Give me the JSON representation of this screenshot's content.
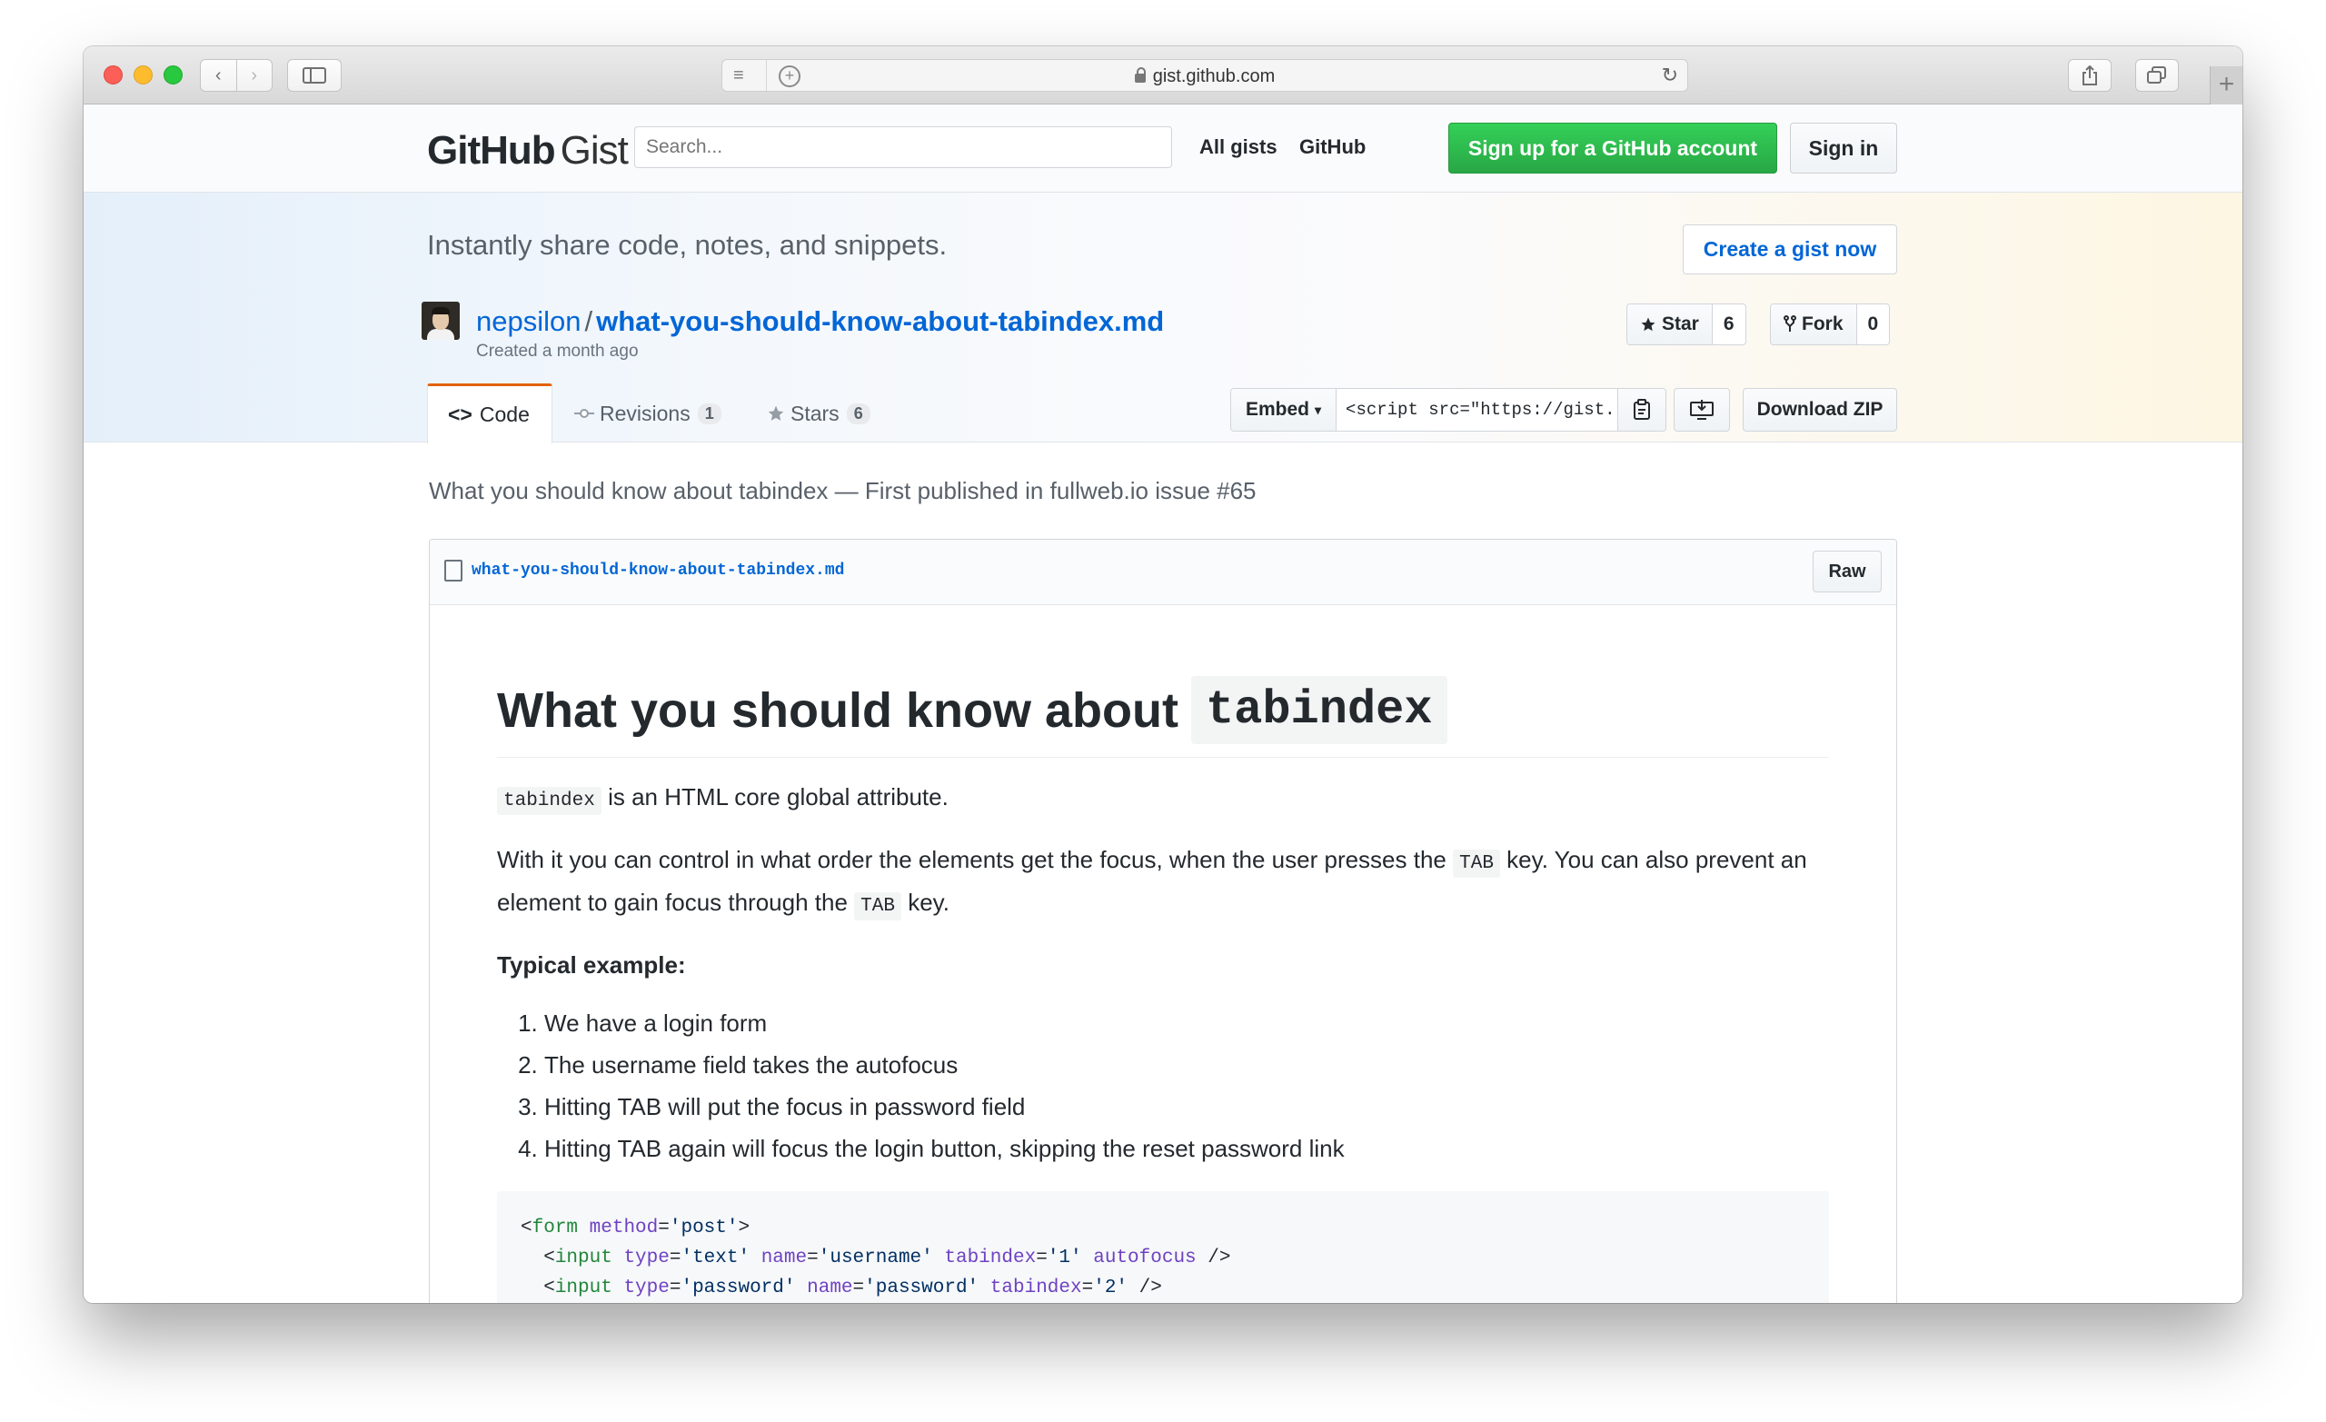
{
  "browser": {
    "url": "gist.github.com"
  },
  "header": {
    "logo_bold": "GitHub",
    "logo_light": "Gist",
    "search_placeholder": "Search...",
    "nav_all_gists": "All gists",
    "nav_github": "GitHub",
    "signup": "Sign up for a GitHub account",
    "signin": "Sign in"
  },
  "hero": {
    "tagline": "Instantly share code, notes, and snippets.",
    "create_button": "Create a gist now",
    "owner": "nepsilon",
    "separator": "/",
    "gist_name": "what-you-should-know-about-tabindex.md",
    "created": "Created a month ago",
    "star_label": "Star",
    "star_count": "6",
    "fork_label": "Fork",
    "fork_count": "0"
  },
  "tabs": {
    "code": "Code",
    "revisions": "Revisions",
    "revisions_count": "1",
    "stars": "Stars",
    "stars_count": "6"
  },
  "embed": {
    "label": "Embed",
    "code": "<script src=\"https://gist.",
    "download_zip": "Download ZIP"
  },
  "content": {
    "description": "What you should know about tabindex — First published in fullweb.io issue #65",
    "filename": "what-you-should-know-about-tabindex.md",
    "raw": "Raw",
    "h1_text": "What you should know about",
    "h1_code": "tabindex",
    "p1_code": "tabindex",
    "p1_text": "is an HTML core global attribute.",
    "p2_a": "With it you can control in what order the elements get the focus, when the user presses the",
    "p2_tab1": "TAB",
    "p2_b": "key. You can also prevent an element to gain focus through the",
    "p2_tab2": "TAB",
    "p2_c": "key.",
    "typical": "Typical example:",
    "list": [
      "We have a login form",
      "The username field takes the autofocus",
      "Hitting TAB will put the focus in password field",
      "Hitting TAB again will focus the login button, skipping the reset password link"
    ],
    "code_lines": [
      "<form method='post'>",
      "  <input type='text' name='username' tabindex='1' autofocus />",
      "  <input type='password' name='password' tabindex='2' />"
    ]
  }
}
